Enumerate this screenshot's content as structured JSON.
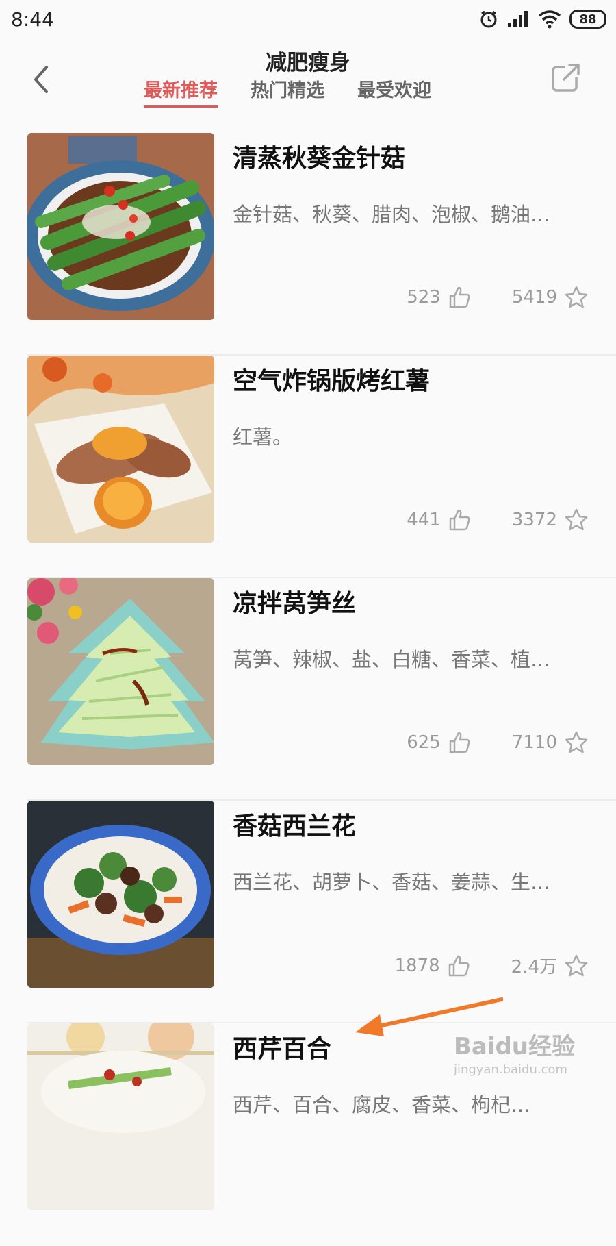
{
  "status_bar": {
    "time": "8:44",
    "battery": "88"
  },
  "header": {
    "title": "减肥瘦身",
    "tabs": [
      {
        "label": "最新推荐",
        "active": true
      },
      {
        "label": "热门精选",
        "active": false
      },
      {
        "label": "最受欢迎",
        "active": false
      }
    ]
  },
  "recipes": [
    {
      "name": "清蒸秋葵金针菇",
      "ingredients": "金针菇、秋葵、腊肉、泡椒、鹅油…",
      "likes": "523",
      "favorites": "5419"
    },
    {
      "name": "空气炸锅版烤红薯",
      "ingredients": "红薯。",
      "likes": "441",
      "favorites": "3372"
    },
    {
      "name": "凉拌莴笋丝",
      "ingredients": "莴笋、辣椒、盐、白糖、香菜、植…",
      "likes": "625",
      "favorites": "7110"
    },
    {
      "name": "香菇西兰花",
      "ingredients": "西兰花、胡萝卜、香菇、姜蒜、生…",
      "likes": "1878",
      "favorites": "2.4万"
    },
    {
      "name": "西芹百合",
      "ingredients": "西芹、百合、腐皮、香菜、枸杞…",
      "likes": "",
      "favorites": ""
    }
  ],
  "watermark": {
    "brand": "Baidu经验",
    "url": "jingyan.baidu.com"
  },
  "colors": {
    "accent": "#e05a5a",
    "arrow": "#f07a2a"
  }
}
